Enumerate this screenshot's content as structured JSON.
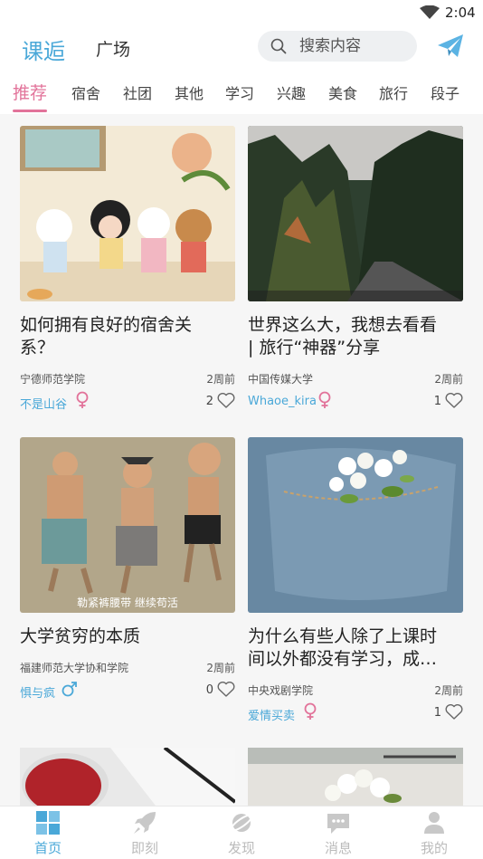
{
  "status_bar": {
    "time": "2:04"
  },
  "header": {
    "app_title": "课逅",
    "plaza_label": "广场",
    "search_placeholder": "搜索内容"
  },
  "tabs": [
    "推荐",
    "宿舍",
    "社团",
    "其他",
    "学习",
    "兴趣",
    "美食",
    "旅行",
    "段子"
  ],
  "active_tab": "推荐",
  "cards": [
    {
      "title_line1": "如何拥有良好的宿舍关",
      "title_line2": "系？",
      "school": "宁德师范学院",
      "time": "2周前",
      "author": "不是山谷",
      "gender": "female",
      "likes": "2"
    },
    {
      "title_line1": "世界这么大，我想去看看",
      "title_line2": "| 旅行“神器”分享",
      "school": "中国传媒大学",
      "time": "2周前",
      "author": "Whaoe_kira",
      "gender": "female",
      "likes": "1"
    },
    {
      "title_line1": "大学贫穷的本质",
      "title_line2": "",
      "school": "福建师范大学协和学院",
      "time": "2周前",
      "author": "惧与疯",
      "gender": "male",
      "likes": "0",
      "image_caption": "勒紧裤腰带 继续苟活"
    },
    {
      "title_line1": "为什么有些人除了上课时",
      "title_line2": "间以外都没有学习，成…",
      "school": "中央戏剧学院",
      "time": "2周前",
      "author": "爱情买卖",
      "gender": "female",
      "likes": "1"
    }
  ],
  "bottom_nav": [
    {
      "label": "首页",
      "icon": "home-icon",
      "active": true
    },
    {
      "label": "即刻",
      "icon": "rocket-icon",
      "active": false
    },
    {
      "label": "发现",
      "icon": "planet-icon",
      "active": false
    },
    {
      "label": "消息",
      "icon": "chat-bubble-icon",
      "active": false
    },
    {
      "label": "我的",
      "icon": "person-icon",
      "active": false
    }
  ],
  "colors": {
    "accent_blue": "#4aa8d8",
    "accent_pink": "#e2739a",
    "female_icon": "#e2739a",
    "male_icon": "#4aa8d8"
  }
}
